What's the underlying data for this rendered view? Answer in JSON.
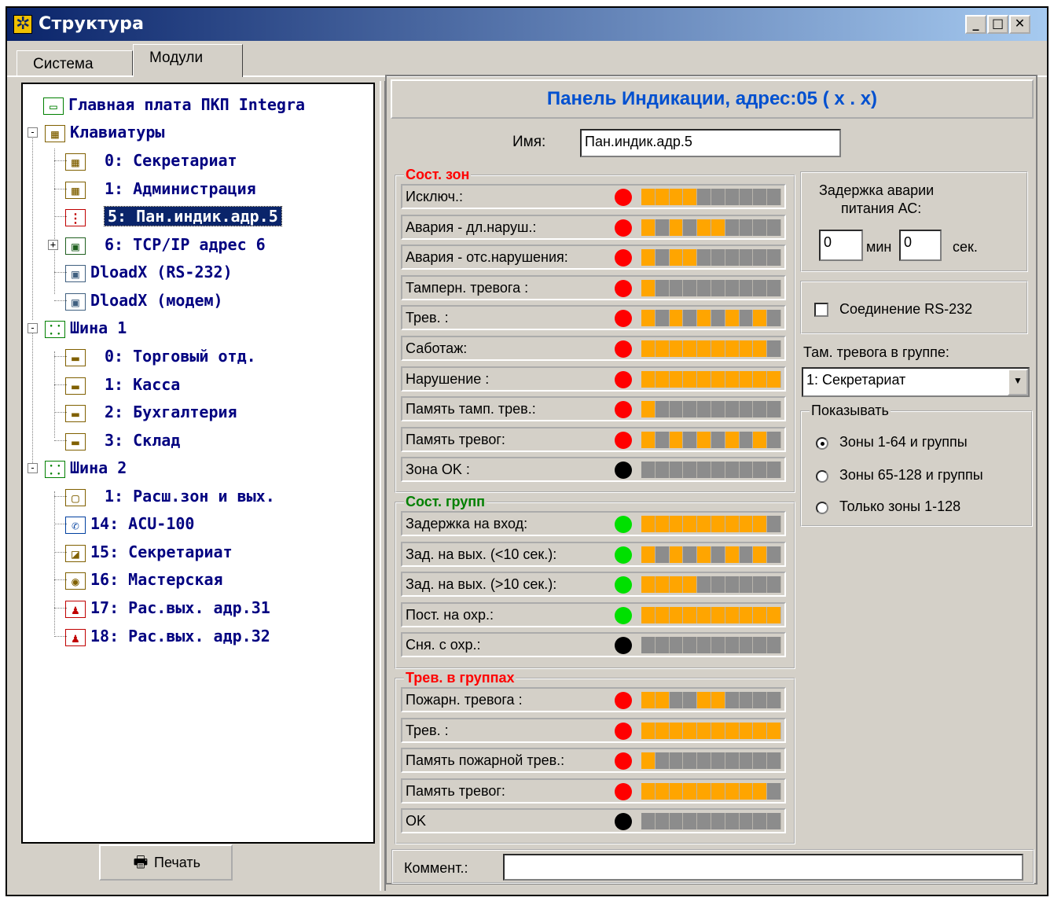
{
  "window": {
    "title": "Структура"
  },
  "tabs": [
    {
      "label": "Система"
    },
    {
      "label": "Модули"
    }
  ],
  "tree": {
    "items": [
      {
        "label": "Главная плата ПКП Integra",
        "icon": "mainboard-icon"
      },
      {
        "label": "Клавиатуры",
        "icon": "keypad-group-icon"
      },
      {
        "label": "0: Секретариат",
        "icon": "keypad-icon"
      },
      {
        "label": "1: Администрация",
        "icon": "keypad-icon"
      },
      {
        "label": "5: Пан.индик.адр.5",
        "icon": "traffic-light-icon"
      },
      {
        "label": "6: TCP/IP адрес 6",
        "icon": "network-module-icon"
      },
      {
        "label": "DloadX (RS-232)",
        "icon": "computer-icon"
      },
      {
        "label": "DloadX (модем)",
        "icon": "computer-icon"
      },
      {
        "label": "Шина 1",
        "icon": "bus-icon"
      },
      {
        "label": "0: Торговый отд.",
        "icon": "reader-icon"
      },
      {
        "label": "1: Касса",
        "icon": "reader-icon"
      },
      {
        "label": "2: Бухгалтерия",
        "icon": "reader-icon"
      },
      {
        "label": "3: Склад",
        "icon": "reader-key-icon"
      },
      {
        "label": "Шина 2",
        "icon": "bus-icon"
      },
      {
        "label": "1: Расш.зон и вых.",
        "icon": "expander-icon"
      },
      {
        "label": "14: ACU-100",
        "icon": "wireless-icon"
      },
      {
        "label": "15: Секретариат",
        "icon": "card-reader-icon"
      },
      {
        "label": "16: Мастерская",
        "icon": "dallas-icon"
      },
      {
        "label": "17: Рас.вых. адр.31",
        "icon": "output-expander-icon"
      },
      {
        "label": "18: Рас.вых. адр.32",
        "icon": "output-expander-icon"
      }
    ],
    "print_label": "Печать"
  },
  "panel": {
    "header": "Панель Индикации, адрес:05 ( x . x)",
    "name_label": "Имя:",
    "name_value": "Пан.индик.адр.5",
    "comment_label": "Коммент.:",
    "comment_value": ""
  },
  "zones": {
    "title": "Сост. зон",
    "rows": [
      {
        "label": "Исключ.:",
        "color": "#ff0000",
        "pattern": "1111000000"
      },
      {
        "label": "Авария - дл.наруш.:",
        "color": "#ff0000",
        "pattern": "1010110000"
      },
      {
        "label": "Авария - отс.нарушения:",
        "color": "#ff0000",
        "pattern": "1011000000"
      },
      {
        "label": "Тамперн. тревога :",
        "color": "#ff0000",
        "pattern": "1000000000"
      },
      {
        "label": "Трев. :",
        "color": "#ff0000",
        "pattern": "1010101010"
      },
      {
        "label": "Саботаж:",
        "color": "#ff0000",
        "pattern": "1111111110"
      },
      {
        "label": "Нарушение :",
        "color": "#ff0000",
        "pattern": "1111111111"
      },
      {
        "label": "Память тамп. трев.:",
        "color": "#ff0000",
        "pattern": "1000000000"
      },
      {
        "label": "Память тревог:",
        "color": "#ff0000",
        "pattern": "1010101010"
      },
      {
        "label": "Зона OK :",
        "color": "#000000",
        "pattern": "0000000000"
      }
    ]
  },
  "groups": {
    "title": "Сост. групп",
    "rows": [
      {
        "label": "Задержка на вход:",
        "color": "#00e000",
        "pattern": "1111111110"
      },
      {
        "label": "Зад. на вых. (<10 сек.):",
        "color": "#00e000",
        "pattern": "1010101010"
      },
      {
        "label": "Зад. на вых. (>10 сек.):",
        "color": "#00e000",
        "pattern": "1111000000"
      },
      {
        "label": "Пост. на охр.:",
        "color": "#00e000",
        "pattern": "1111111111"
      },
      {
        "label": "Сня. с охр.:",
        "color": "#000000",
        "pattern": "0000000000"
      }
    ]
  },
  "alarms": {
    "title": "Трев. в группах",
    "rows": [
      {
        "label": "Пожарн. тревога :",
        "color": "#ff0000",
        "pattern": "1100110000"
      },
      {
        "label": "Трев. :",
        "color": "#ff0000",
        "pattern": "1111111111"
      },
      {
        "label": "Память пожарной трев.:",
        "color": "#ff0000",
        "pattern": "1000000000"
      },
      {
        "label": "Память тревог:",
        "color": "#ff0000",
        "pattern": "1111111110"
      },
      {
        "label": "OK",
        "color": "#000000",
        "pattern": "0000000000"
      }
    ]
  },
  "ac_delay": {
    "title_line1": "Задержка аварии",
    "title_line2": "питания АС:",
    "min_value": "0",
    "min_label": "мин",
    "sec_value": "0",
    "sec_label": "сек."
  },
  "rs232": {
    "label": "Соединение RS-232",
    "checked": false
  },
  "tamper_group": {
    "label": "Там. тревога в группе:",
    "selected": "1: Секретариат"
  },
  "show": {
    "title": "Показывать",
    "options": [
      {
        "label": "Зоны 1-64 и группы",
        "selected": true
      },
      {
        "label": "Зоны 65-128 и группы",
        "selected": false
      },
      {
        "label": "Только зоны 1-128",
        "selected": false
      }
    ]
  },
  "colors": {
    "segment_on": "#ffa500",
    "segment_off": "#8c8c8c",
    "title_red": "#ff0000",
    "title_green": "#008000"
  }
}
